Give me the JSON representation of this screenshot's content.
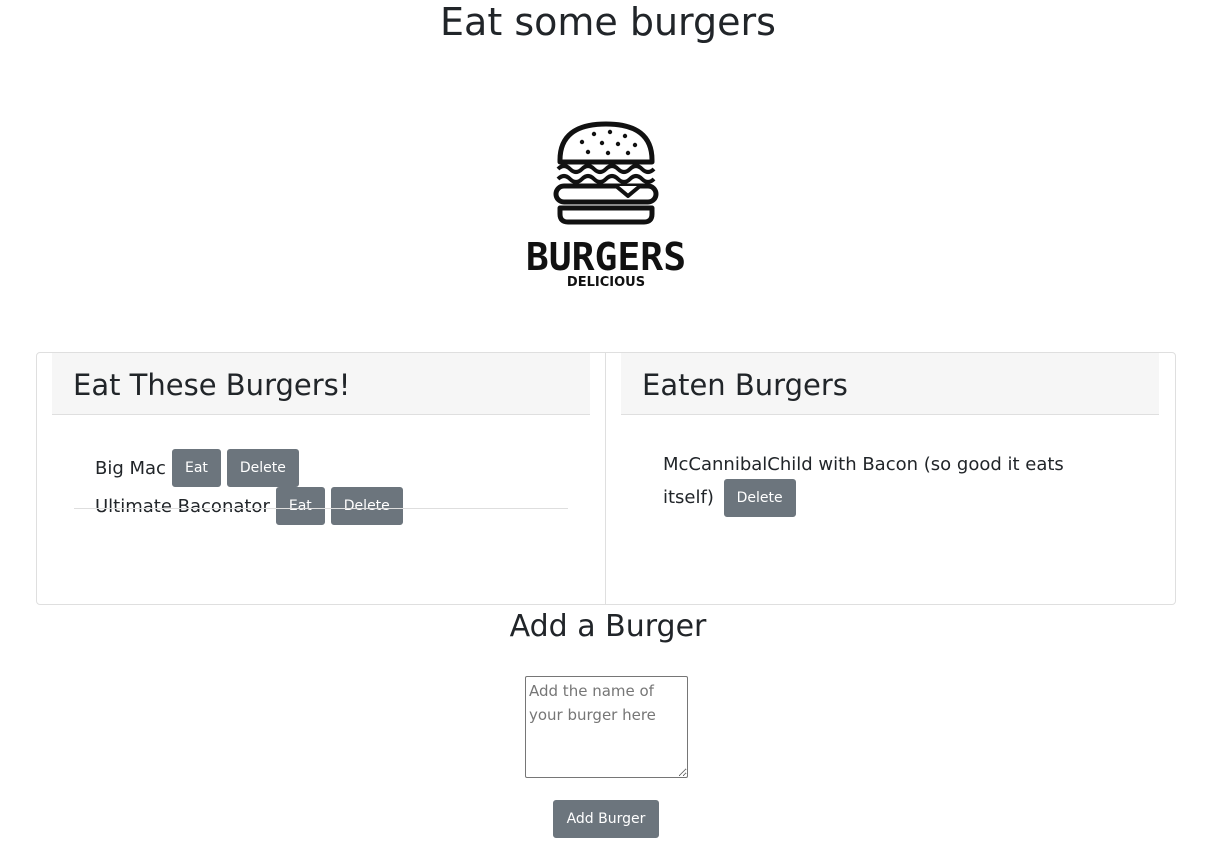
{
  "page": {
    "title": "Eat some burgers"
  },
  "logo": {
    "brand_text": "BURGERS",
    "tagline": "DELICIOUS",
    "icon": "burger-icon"
  },
  "uneaten": {
    "heading": "Eat These Burgers!",
    "items": [
      {
        "name": "Big Mac",
        "eat_label": "Eat",
        "delete_label": "Delete"
      },
      {
        "name": "Ultimate Baconator",
        "eat_label": "Eat",
        "delete_label": "Delete"
      }
    ]
  },
  "eaten": {
    "heading": "Eaten Burgers",
    "items": [
      {
        "name": "McCannibalChild with Bacon (so good it eats itself)",
        "delete_label": "Delete"
      }
    ]
  },
  "add_form": {
    "heading": "Add a Burger",
    "placeholder": "Add the name of your burger here",
    "value": "",
    "submit_label": "Add Burger"
  },
  "colors": {
    "button_bg": "#6c757d",
    "header_bg": "#f6f6f6",
    "border": "#dfdfdf"
  }
}
